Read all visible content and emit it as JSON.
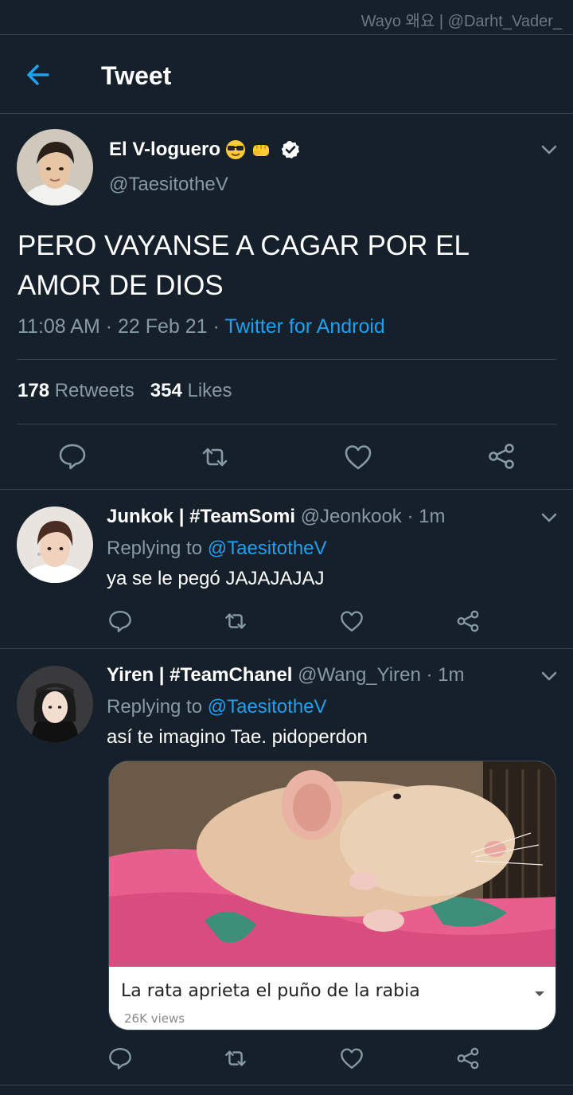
{
  "watermark": "Wayo 왜요 | @Darht_Vader_",
  "header": {
    "title": "Tweet"
  },
  "tweet": {
    "name": "El V-loguero",
    "handle": "@TaesitotheV",
    "text": "PERO VAYANSE A CAGAR POR EL AMOR DE DIOS",
    "time": "11:08 AM · 22 Feb 21 · ",
    "source": "Twitter for Android",
    "retweets": "178",
    "retweets_label": "Retweets",
    "likes": "354",
    "likes_label": "Likes"
  },
  "replies": [
    {
      "name": "Junkok | #TeamSomi",
      "handle": "@Jeonkook",
      "age": " · 1m",
      "replying_label": "Replying to ",
      "replying_to": "@TaesitotheV",
      "text": "ya se le pegó JAJAJAJAJ"
    },
    {
      "name": "Yiren | #TeamChanel",
      "handle": "@Wang_Yiren",
      "age": " · 1m",
      "replying_label": "Replying to ",
      "replying_to": "@TaesitotheV",
      "text": "así te imagino Tae. pidoperdon",
      "media": {
        "caption": "La rata aprieta el puño de la rabia",
        "views": "26K views"
      }
    }
  ],
  "colors": {
    "background": "#15202b",
    "accent": "#1da1f2",
    "muted": "#8899a6",
    "divider": "#38444d"
  },
  "icons": [
    "back-arrow-icon",
    "chevron-down-icon",
    "verified-badge-icon",
    "reply-icon",
    "retweet-icon",
    "like-icon",
    "share-icon"
  ]
}
